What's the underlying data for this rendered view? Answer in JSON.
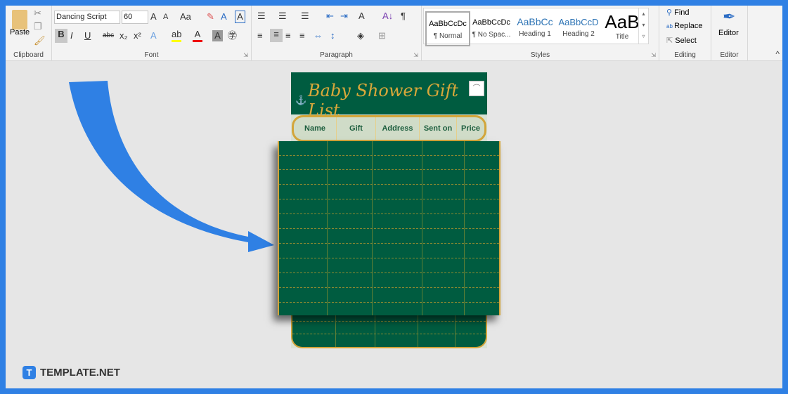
{
  "ribbon": {
    "clipboard": {
      "label": "Clipboard",
      "paste": "Paste"
    },
    "font": {
      "label": "Font",
      "font_name": "Dancing Script",
      "font_size": "60",
      "change_case": "Aa"
    },
    "paragraph": {
      "label": "Paragraph"
    },
    "styles": {
      "label": "Styles",
      "items": [
        {
          "preview": "AaBbCcDc",
          "name": "¶ Normal"
        },
        {
          "preview": "AaBbCcDc",
          "name": "¶ No Spac..."
        },
        {
          "preview": "AaBbCc",
          "name": "Heading 1"
        },
        {
          "preview": "AaBbCcD",
          "name": "Heading 2"
        },
        {
          "preview": "AaB",
          "name": "Title"
        }
      ]
    },
    "editing": {
      "label": "Editing",
      "find": "Find",
      "replace": "Replace",
      "select": "Select"
    },
    "editor": {
      "label": "Editor",
      "button": "Editor"
    }
  },
  "document": {
    "title": "Baby Shower Gift List",
    "columns": [
      "Name",
      "Gift",
      "Address",
      "Sent on",
      "Price"
    ]
  },
  "watermark": {
    "brand": "TEMPLATE.NET"
  },
  "colors": {
    "frame": "#2f80e4",
    "table_green": "#005c40",
    "gold": "#d3a53a",
    "arrow": "#2f80e4"
  }
}
